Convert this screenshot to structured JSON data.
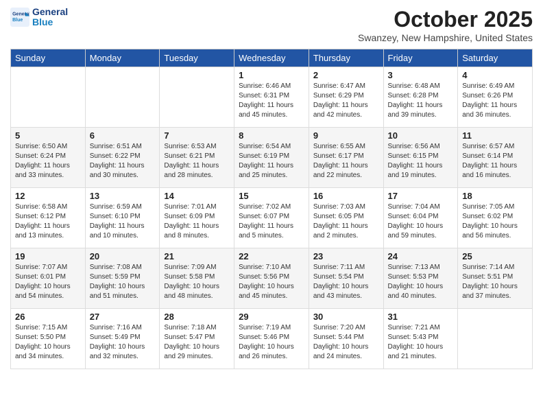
{
  "header": {
    "logo_line1": "General",
    "logo_line2": "Blue",
    "month": "October 2025",
    "location": "Swanzey, New Hampshire, United States"
  },
  "days_of_week": [
    "Sunday",
    "Monday",
    "Tuesday",
    "Wednesday",
    "Thursday",
    "Friday",
    "Saturday"
  ],
  "weeks": [
    [
      {
        "day": "",
        "info": ""
      },
      {
        "day": "",
        "info": ""
      },
      {
        "day": "",
        "info": ""
      },
      {
        "day": "1",
        "info": "Sunrise: 6:46 AM\nSunset: 6:31 PM\nDaylight: 11 hours\nand 45 minutes."
      },
      {
        "day": "2",
        "info": "Sunrise: 6:47 AM\nSunset: 6:29 PM\nDaylight: 11 hours\nand 42 minutes."
      },
      {
        "day": "3",
        "info": "Sunrise: 6:48 AM\nSunset: 6:28 PM\nDaylight: 11 hours\nand 39 minutes."
      },
      {
        "day": "4",
        "info": "Sunrise: 6:49 AM\nSunset: 6:26 PM\nDaylight: 11 hours\nand 36 minutes."
      }
    ],
    [
      {
        "day": "5",
        "info": "Sunrise: 6:50 AM\nSunset: 6:24 PM\nDaylight: 11 hours\nand 33 minutes."
      },
      {
        "day": "6",
        "info": "Sunrise: 6:51 AM\nSunset: 6:22 PM\nDaylight: 11 hours\nand 30 minutes."
      },
      {
        "day": "7",
        "info": "Sunrise: 6:53 AM\nSunset: 6:21 PM\nDaylight: 11 hours\nand 28 minutes."
      },
      {
        "day": "8",
        "info": "Sunrise: 6:54 AM\nSunset: 6:19 PM\nDaylight: 11 hours\nand 25 minutes."
      },
      {
        "day": "9",
        "info": "Sunrise: 6:55 AM\nSunset: 6:17 PM\nDaylight: 11 hours\nand 22 minutes."
      },
      {
        "day": "10",
        "info": "Sunrise: 6:56 AM\nSunset: 6:15 PM\nDaylight: 11 hours\nand 19 minutes."
      },
      {
        "day": "11",
        "info": "Sunrise: 6:57 AM\nSunset: 6:14 PM\nDaylight: 11 hours\nand 16 minutes."
      }
    ],
    [
      {
        "day": "12",
        "info": "Sunrise: 6:58 AM\nSunset: 6:12 PM\nDaylight: 11 hours\nand 13 minutes."
      },
      {
        "day": "13",
        "info": "Sunrise: 6:59 AM\nSunset: 6:10 PM\nDaylight: 11 hours\nand 10 minutes."
      },
      {
        "day": "14",
        "info": "Sunrise: 7:01 AM\nSunset: 6:09 PM\nDaylight: 11 hours\nand 8 minutes."
      },
      {
        "day": "15",
        "info": "Sunrise: 7:02 AM\nSunset: 6:07 PM\nDaylight: 11 hours\nand 5 minutes."
      },
      {
        "day": "16",
        "info": "Sunrise: 7:03 AM\nSunset: 6:05 PM\nDaylight: 11 hours\nand 2 minutes."
      },
      {
        "day": "17",
        "info": "Sunrise: 7:04 AM\nSunset: 6:04 PM\nDaylight: 10 hours\nand 59 minutes."
      },
      {
        "day": "18",
        "info": "Sunrise: 7:05 AM\nSunset: 6:02 PM\nDaylight: 10 hours\nand 56 minutes."
      }
    ],
    [
      {
        "day": "19",
        "info": "Sunrise: 7:07 AM\nSunset: 6:01 PM\nDaylight: 10 hours\nand 54 minutes."
      },
      {
        "day": "20",
        "info": "Sunrise: 7:08 AM\nSunset: 5:59 PM\nDaylight: 10 hours\nand 51 minutes."
      },
      {
        "day": "21",
        "info": "Sunrise: 7:09 AM\nSunset: 5:58 PM\nDaylight: 10 hours\nand 48 minutes."
      },
      {
        "day": "22",
        "info": "Sunrise: 7:10 AM\nSunset: 5:56 PM\nDaylight: 10 hours\nand 45 minutes."
      },
      {
        "day": "23",
        "info": "Sunrise: 7:11 AM\nSunset: 5:54 PM\nDaylight: 10 hours\nand 43 minutes."
      },
      {
        "day": "24",
        "info": "Sunrise: 7:13 AM\nSunset: 5:53 PM\nDaylight: 10 hours\nand 40 minutes."
      },
      {
        "day": "25",
        "info": "Sunrise: 7:14 AM\nSunset: 5:51 PM\nDaylight: 10 hours\nand 37 minutes."
      }
    ],
    [
      {
        "day": "26",
        "info": "Sunrise: 7:15 AM\nSunset: 5:50 PM\nDaylight: 10 hours\nand 34 minutes."
      },
      {
        "day": "27",
        "info": "Sunrise: 7:16 AM\nSunset: 5:49 PM\nDaylight: 10 hours\nand 32 minutes."
      },
      {
        "day": "28",
        "info": "Sunrise: 7:18 AM\nSunset: 5:47 PM\nDaylight: 10 hours\nand 29 minutes."
      },
      {
        "day": "29",
        "info": "Sunrise: 7:19 AM\nSunset: 5:46 PM\nDaylight: 10 hours\nand 26 minutes."
      },
      {
        "day": "30",
        "info": "Sunrise: 7:20 AM\nSunset: 5:44 PM\nDaylight: 10 hours\nand 24 minutes."
      },
      {
        "day": "31",
        "info": "Sunrise: 7:21 AM\nSunset: 5:43 PM\nDaylight: 10 hours\nand 21 minutes."
      },
      {
        "day": "",
        "info": ""
      }
    ]
  ]
}
